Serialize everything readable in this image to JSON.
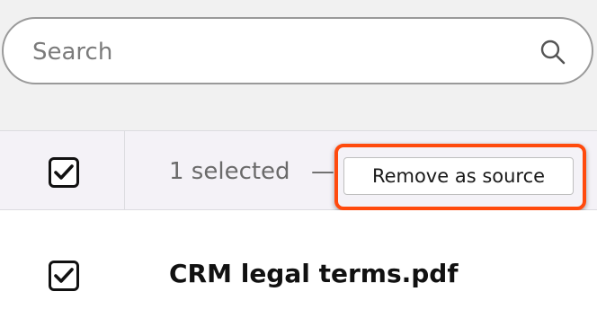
{
  "search": {
    "placeholder": "Search",
    "icon": "search-icon"
  },
  "table": {
    "header": {
      "select_all_checked": true,
      "selected_text": "1 selected",
      "separator": "—",
      "remove_button_label": "Remove as source"
    },
    "rows": [
      {
        "checked": true,
        "file_name": "CRM legal terms.pdf"
      }
    ]
  },
  "colors": {
    "highlight": "#ff4a0d",
    "header_background": "#f4f2f7",
    "page_background": "#f1f1f1"
  }
}
